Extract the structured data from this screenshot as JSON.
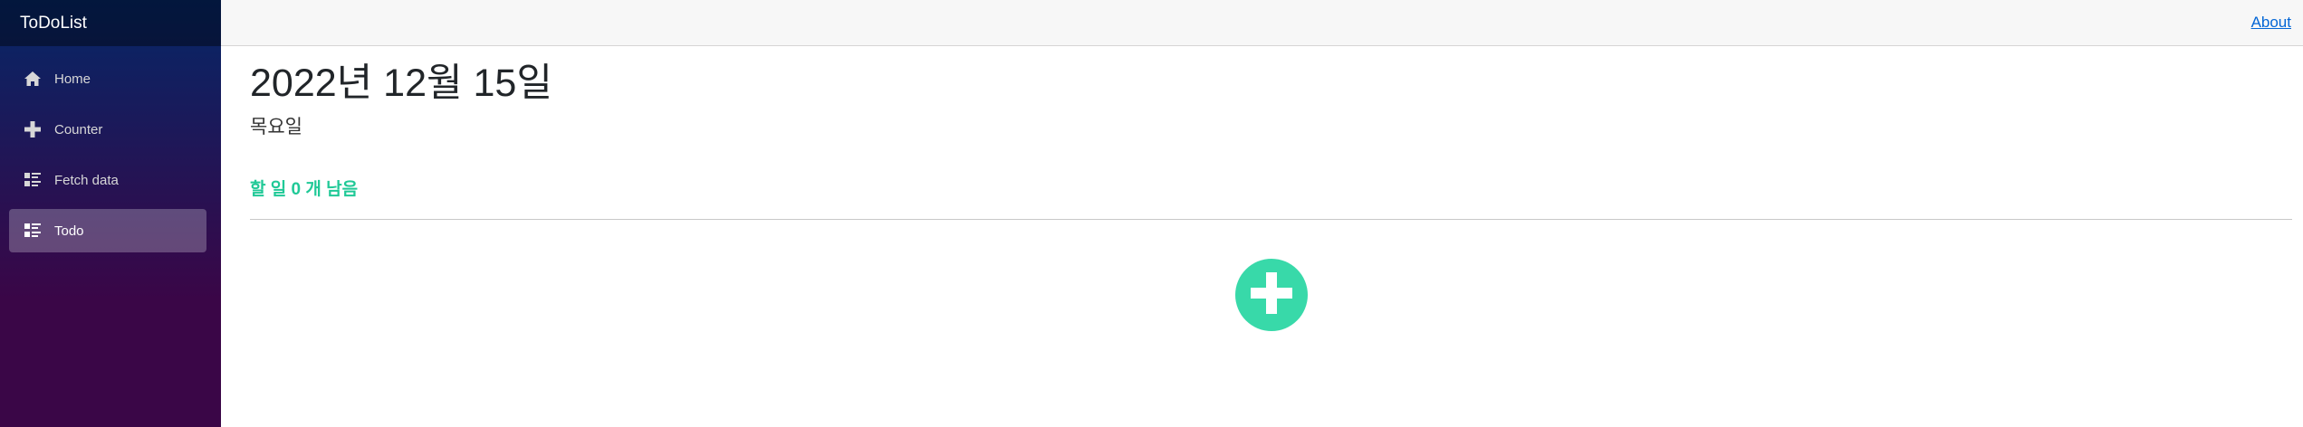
{
  "app": {
    "brand": "ToDoList"
  },
  "sidebar": {
    "items": [
      {
        "label": "Home",
        "icon": "home-icon",
        "active": false
      },
      {
        "label": "Counter",
        "icon": "plus-icon",
        "active": false
      },
      {
        "label": "Fetch data",
        "icon": "list-rich-icon",
        "active": false
      },
      {
        "label": "Todo",
        "icon": "list-rich-icon",
        "active": true
      }
    ]
  },
  "header": {
    "about_label": "About"
  },
  "todo": {
    "date": "2022년 12월 15일",
    "weekday": "목요일",
    "remaining": "할 일 0 개 남음",
    "add_icon": "plus-icon"
  },
  "colors": {
    "accent": "#38d9a9",
    "remaining_text": "#20c997",
    "link": "#0366d6"
  }
}
